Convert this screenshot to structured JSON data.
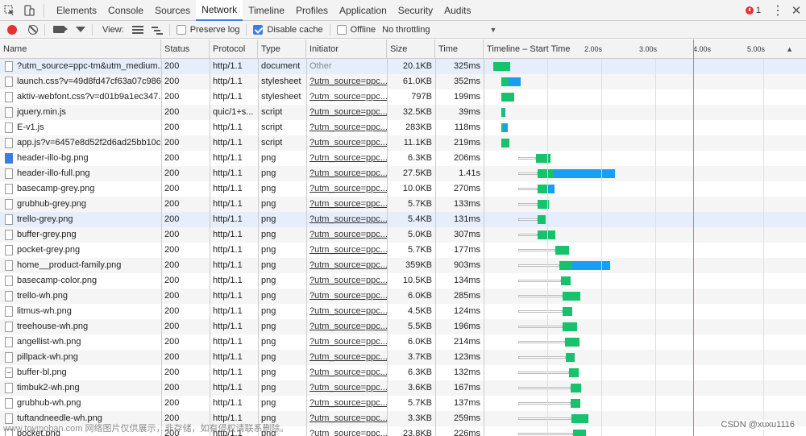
{
  "tabs": [
    "Elements",
    "Console",
    "Sources",
    "Network",
    "Timeline",
    "Profiles",
    "Application",
    "Security",
    "Audits"
  ],
  "active_tab": "Network",
  "errors": {
    "count": "1"
  },
  "toolbar": {
    "view_label": "View:",
    "preserve_log": "Preserve log",
    "disable_cache": "Disable cache",
    "offline": "Offline",
    "throttling": "No throttling"
  },
  "columns": {
    "name": "Name",
    "status": "Status",
    "protocol": "Protocol",
    "type": "Type",
    "initiator": "Initiator",
    "size": "Size",
    "time": "Time",
    "timeline": "Timeline – Start Time"
  },
  "timeline_ticks": [
    "2.00s",
    "3.00s",
    "4.00s",
    "5.00s"
  ],
  "rows": [
    {
      "name": "?utm_source=ppc-tm&utm_medium...",
      "status": "200",
      "protocol": "http/1.1",
      "type": "document",
      "initiator": "Other",
      "size": "20.1KB",
      "time": "325ms",
      "icon": "doc",
      "bar": {
        "start": 0.28,
        "ttfb": 0.32,
        "dl": 0.0
      }
    },
    {
      "name": "launch.css?v=49d8fd47cf63a07c986...",
      "status": "200",
      "protocol": "http/1.1",
      "type": "stylesheet",
      "initiator": "?utm_source=ppc...",
      "size": "61.0KB",
      "time": "352ms",
      "icon": "doc",
      "bar": {
        "start": 0.54,
        "ttfb": 0.14,
        "dl": 0.22
      }
    },
    {
      "name": "aktiv-webfont.css?v=d01b9a1ec347...",
      "status": "200",
      "protocol": "http/1.1",
      "type": "stylesheet",
      "initiator": "?utm_source=ppc...",
      "size": "797B",
      "time": "199ms",
      "icon": "doc",
      "bar": {
        "start": 0.54,
        "ttfb": 0.24,
        "dl": 0.0
      }
    },
    {
      "name": "jquery.min.js",
      "status": "200",
      "protocol": "quic/1+s...",
      "type": "script",
      "initiator": "?utm_source=ppc...",
      "size": "32.5KB",
      "time": "39ms",
      "icon": "doc",
      "bar": {
        "start": 0.54,
        "ttfb": 0.06,
        "dl": 0.02
      }
    },
    {
      "name": "E-v1.js",
      "status": "200",
      "protocol": "http/1.1",
      "type": "script",
      "initiator": "?utm_source=ppc...",
      "size": "283KB",
      "time": "118ms",
      "icon": "doc",
      "bar": {
        "start": 0.54,
        "ttfb": 0.05,
        "dl": 0.07
      }
    },
    {
      "name": "app.js?v=6457e8d52f2d6ad25bb10c...",
      "status": "200",
      "protocol": "http/1.1",
      "type": "script",
      "initiator": "?utm_source=ppc...",
      "size": "11.1KB",
      "time": "219ms",
      "icon": "doc",
      "bar": {
        "start": 0.54,
        "ttfb": 0.16,
        "dl": 0.0
      }
    },
    {
      "name": "header-illo-bg.png",
      "status": "200",
      "protocol": "http/1.1",
      "type": "png",
      "initiator": "?utm_source=ppc...",
      "size": "6.3KB",
      "time": "206ms",
      "icon": "img",
      "bar": {
        "start": 0.58,
        "wait": 0.6,
        "ttfb": 0.26,
        "dl": 0.0
      }
    },
    {
      "name": "header-illo-full.png",
      "status": "200",
      "protocol": "http/1.1",
      "type": "png",
      "initiator": "?utm_source=ppc...",
      "size": "27.5KB",
      "time": "1.41s",
      "icon": "doc",
      "bar": {
        "start": 0.58,
        "wait": 0.64,
        "ttfb": 0.3,
        "dl": 1.14
      }
    },
    {
      "name": "basecamp-grey.png",
      "status": "200",
      "protocol": "http/1.1",
      "type": "png",
      "initiator": "?utm_source=ppc...",
      "size": "10.0KB",
      "time": "270ms",
      "icon": "doc",
      "bar": {
        "start": 0.58,
        "wait": 0.64,
        "ttfb": 0.2,
        "dl": 0.12
      }
    },
    {
      "name": "grubhub-grey.png",
      "status": "200",
      "protocol": "http/1.1",
      "type": "png",
      "initiator": "?utm_source=ppc...",
      "size": "5.7KB",
      "time": "133ms",
      "icon": "doc",
      "bar": {
        "start": 0.58,
        "wait": 0.64,
        "ttfb": 0.22,
        "dl": 0.0
      }
    },
    {
      "name": "trello-grey.png",
      "status": "200",
      "protocol": "http/1.1",
      "type": "png",
      "initiator": "?utm_source=ppc...",
      "size": "5.4KB",
      "time": "131ms",
      "icon": "doc",
      "bar": {
        "start": 0.58,
        "wait": 0.64,
        "ttfb": 0.16,
        "dl": 0.0
      }
    },
    {
      "name": "buffer-grey.png",
      "status": "200",
      "protocol": "http/1.1",
      "type": "png",
      "initiator": "?utm_source=ppc...",
      "size": "5.0KB",
      "time": "307ms",
      "icon": "doc",
      "bar": {
        "start": 0.58,
        "wait": 0.64,
        "ttfb": 0.34,
        "dl": 0.0
      }
    },
    {
      "name": "pocket-grey.png",
      "status": "200",
      "protocol": "http/1.1",
      "type": "png",
      "initiator": "?utm_source=ppc...",
      "size": "5.7KB",
      "time": "177ms",
      "icon": "doc",
      "bar": {
        "start": 0.58,
        "wait": 1.26,
        "ttfb": 0.24,
        "dl": 0.0
      }
    },
    {
      "name": "home__product-family.png",
      "status": "200",
      "protocol": "http/1.1",
      "type": "png",
      "initiator": "?utm_source=ppc...",
      "size": "359KB",
      "time": "903ms",
      "icon": "doc",
      "bar": {
        "start": 0.58,
        "wait": 1.38,
        "ttfb": 0.24,
        "dl": 0.7
      }
    },
    {
      "name": "basecamp-color.png",
      "status": "200",
      "protocol": "http/1.1",
      "type": "png",
      "initiator": "?utm_source=ppc...",
      "size": "10.5KB",
      "time": "134ms",
      "icon": "doc",
      "bar": {
        "start": 0.58,
        "wait": 1.44,
        "ttfb": 0.18,
        "dl": 0.0
      }
    },
    {
      "name": "trello-wh.png",
      "status": "200",
      "protocol": "http/1.1",
      "type": "png",
      "initiator": "?utm_source=ppc...",
      "size": "6.0KB",
      "time": "285ms",
      "icon": "doc",
      "bar": {
        "start": 0.58,
        "wait": 1.48,
        "ttfb": 0.34,
        "dl": 0.0
      }
    },
    {
      "name": "litmus-wh.png",
      "status": "200",
      "protocol": "http/1.1",
      "type": "png",
      "initiator": "?utm_source=ppc...",
      "size": "4.5KB",
      "time": "124ms",
      "icon": "doc",
      "bar": {
        "start": 0.58,
        "wait": 1.5,
        "ttfb": 0.18,
        "dl": 0.0
      }
    },
    {
      "name": "treehouse-wh.png",
      "status": "200",
      "protocol": "http/1.1",
      "type": "png",
      "initiator": "?utm_source=ppc...",
      "size": "5.5KB",
      "time": "196ms",
      "icon": "doc",
      "bar": {
        "start": 0.58,
        "wait": 1.5,
        "ttfb": 0.26,
        "dl": 0.0
      }
    },
    {
      "name": "angellist-wh.png",
      "status": "200",
      "protocol": "http/1.1",
      "type": "png",
      "initiator": "?utm_source=ppc...",
      "size": "6.0KB",
      "time": "214ms",
      "icon": "doc",
      "bar": {
        "start": 0.58,
        "wait": 1.56,
        "ttfb": 0.28,
        "dl": 0.0
      }
    },
    {
      "name": "pillpack-wh.png",
      "status": "200",
      "protocol": "http/1.1",
      "type": "png",
      "initiator": "?utm_source=ppc...",
      "size": "3.7KB",
      "time": "123ms",
      "icon": "doc",
      "bar": {
        "start": 0.58,
        "wait": 1.6,
        "ttfb": 0.16,
        "dl": 0.0
      }
    },
    {
      "name": "buffer-bl.png",
      "status": "200",
      "protocol": "http/1.1",
      "type": "png",
      "initiator": "?utm_source=ppc...",
      "size": "6.3KB",
      "time": "132ms",
      "icon": "dash",
      "bar": {
        "start": 0.58,
        "wait": 1.7,
        "ttfb": 0.18,
        "dl": 0.0
      }
    },
    {
      "name": "timbuk2-wh.png",
      "status": "200",
      "protocol": "http/1.1",
      "type": "png",
      "initiator": "?utm_source=ppc...",
      "size": "3.6KB",
      "time": "167ms",
      "icon": "doc",
      "bar": {
        "start": 0.58,
        "wait": 1.76,
        "ttfb": 0.2,
        "dl": 0.0
      }
    },
    {
      "name": "grubhub-wh.png",
      "status": "200",
      "protocol": "http/1.1",
      "type": "png",
      "initiator": "?utm_source=ppc...",
      "size": "5.7KB",
      "time": "137ms",
      "icon": "doc",
      "bar": {
        "start": 0.58,
        "wait": 1.76,
        "ttfb": 0.18,
        "dl": 0.0
      }
    },
    {
      "name": "tuftandneedle-wh.png",
      "status": "200",
      "protocol": "http/1.1",
      "type": "png",
      "initiator": "?utm_source=ppc...",
      "size": "3.3KB",
      "time": "259ms",
      "icon": "doc",
      "bar": {
        "start": 0.58,
        "wait": 1.78,
        "ttfb": 0.32,
        "dl": 0.0
      }
    },
    {
      "name": "pocket.png",
      "status": "200",
      "protocol": "http/1.1",
      "type": "png",
      "initiator": "?utm_source=ppc...",
      "size": "23.8KB",
      "time": "226ms",
      "icon": "doc",
      "bar": {
        "start": 0.58,
        "wait": 1.84,
        "ttfb": 0.24,
        "dl": 0.0
      }
    }
  ],
  "colors": {
    "accent": "#3b7de6",
    "ttfb": "#18c16b",
    "download": "#1a9ff0",
    "load_line": "#e57373",
    "record": "#e5322d"
  },
  "watermark": "www.toymoban.com 网络图片仅供展示，非存储，如有侵权请联系删除。",
  "csdn": "CSDN @xuxu1116"
}
